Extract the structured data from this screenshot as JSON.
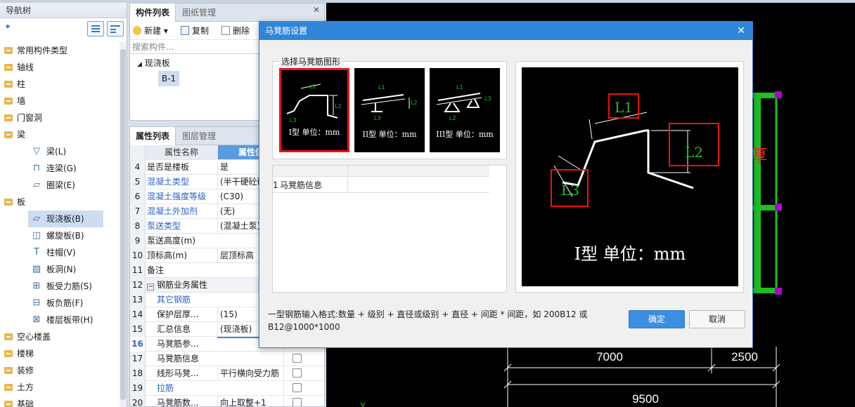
{
  "nav": {
    "title": "导航树",
    "items": [
      {
        "label": "常用构件类型"
      },
      {
        "label": "轴线"
      },
      {
        "label": "柱"
      },
      {
        "label": "墙"
      },
      {
        "label": "门窗洞"
      },
      {
        "label": "梁"
      },
      {
        "label": "梁(L)"
      },
      {
        "label": "连梁(G)"
      },
      {
        "label": "圈梁(E)"
      },
      {
        "label": "板"
      },
      {
        "label": "现浇板(B)"
      },
      {
        "label": "螺旋板(B)"
      },
      {
        "label": "柱帽(V)"
      },
      {
        "label": "板洞(N)"
      },
      {
        "label": "板受力筋(S)"
      },
      {
        "label": "板负筋(F)"
      },
      {
        "label": "楼层板带(H)"
      },
      {
        "label": "空心楼盖"
      },
      {
        "label": "楼梯"
      },
      {
        "label": "装修"
      },
      {
        "label": "土方"
      },
      {
        "label": "基础"
      }
    ]
  },
  "comp": {
    "tab_active": "构件列表",
    "tab_inactive": "图纸管理",
    "new_label": "新建",
    "copy_label": "复制",
    "delete_label": "删除",
    "search_placeholder": "搜索构件...",
    "tree_parent": "现浇板",
    "tree_child": "B-1"
  },
  "prop": {
    "tab_active": "属性列表",
    "tab_inactive": "图层管理",
    "col_name": "属性名称",
    "col_value": "属性值",
    "rows": [
      {
        "n": "4",
        "name": "是否是楼板",
        "value": "是"
      },
      {
        "n": "5",
        "name": "混凝土类型",
        "value": "(半干硬砼碎"
      },
      {
        "n": "6",
        "name": "混凝土强度等级",
        "value": "(C30)"
      },
      {
        "n": "7",
        "name": "混凝土外加剂",
        "value": "(无)"
      },
      {
        "n": "8",
        "name": "泵送类型",
        "value": "(混凝土泵)"
      },
      {
        "n": "9",
        "name": "泵送高度(m)",
        "value": ""
      },
      {
        "n": "10",
        "name": "顶标高(m)",
        "value": "层顶标高"
      },
      {
        "n": "11",
        "name": "备注",
        "value": ""
      },
      {
        "n": "12",
        "name": "钢筋业务属性",
        "value": ""
      },
      {
        "n": "13",
        "name": "其它钢筋",
        "value": ""
      },
      {
        "n": "14",
        "name": "保护层厚...",
        "value": "(15)"
      },
      {
        "n": "15",
        "name": "汇总信息",
        "value": "(现浇板)"
      },
      {
        "n": "16",
        "name": "马凳筋参...",
        "value": ""
      },
      {
        "n": "17",
        "name": "马凳筋信息",
        "value": ""
      },
      {
        "n": "18",
        "name": "线形马凳...",
        "value": "平行横向受力筋"
      },
      {
        "n": "19",
        "name": "拉筋",
        "value": ""
      },
      {
        "n": "20",
        "name": "马凳筋数...",
        "value": "向上取整+1"
      }
    ]
  },
  "dialog": {
    "title": "马凳筋设置",
    "group_label": "选择马凳筋图形",
    "shapes": [
      {
        "caption": "I型 单位：mm",
        "l1": "L1",
        "l2": "L2",
        "l3": "L3"
      },
      {
        "caption": "II型 单位：mm",
        "l1": "L1",
        "l2": "L2",
        "l3": "L3"
      },
      {
        "caption": "III型 单位：mm",
        "l1": "L1",
        "l2": "L2",
        "l3": "L3"
      }
    ],
    "info_row_num": "1",
    "info_row_label": "马凳筋信息",
    "preview_caption": "I型 单位：mm",
    "preview_l1": "L1",
    "preview_l2": "L2",
    "preview_l3": "L3",
    "hint": "一型钢筋输入格式:数量 + 级别 + 直径或级别 + 直径 + 间距 * 间距，如 200B12 或 B12@1000*1000",
    "ok": "确定",
    "cancel": "取消"
  },
  "annotation": "板厚",
  "canvas": {
    "dim1": "7000",
    "dim2": "2500",
    "dim3": "9500",
    "axis_label": "Y"
  },
  "colors": {
    "accent": "#2f86d8",
    "select_red": "#e11111",
    "green_beam": "#1fbf1f",
    "magenta_node": "#b000d0"
  }
}
